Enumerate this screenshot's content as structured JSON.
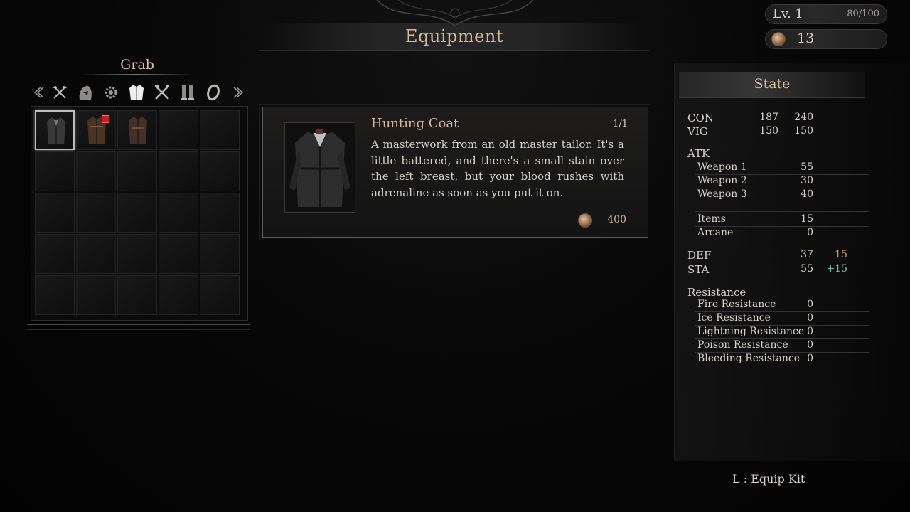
{
  "header": {
    "title": "Equipment",
    "level_label": "Lv. 1",
    "xp": "80/100",
    "currency": "13"
  },
  "inventory": {
    "title": "Grab",
    "categories": [
      {
        "icon": "axe-icon",
        "active": false
      },
      {
        "icon": "hood-icon",
        "active": false
      },
      {
        "icon": "gear-icon",
        "active": false
      },
      {
        "icon": "coat-icon",
        "active": true
      },
      {
        "icon": "crossed-tools-icon",
        "active": false
      },
      {
        "icon": "boots-icon",
        "active": false
      },
      {
        "icon": "ring-icon",
        "active": false
      }
    ],
    "slots": [
      {
        "item": "coat-dark",
        "selected": true,
        "new": false
      },
      {
        "item": "coat-brown",
        "selected": false,
        "new": true
      },
      {
        "item": "coat-brown",
        "selected": false,
        "new": false
      }
    ]
  },
  "detail": {
    "name": "Hunting Coat",
    "count": "1/1",
    "description": "A masterwork from an old master tailor. It's a little battered, and there's a small stain over the left breast, but your blood rushes with adrenaline as soon as you put it on.",
    "price": "400"
  },
  "state": {
    "title": "State",
    "con": {
      "label": "CON",
      "v1": "187",
      "v2": "240"
    },
    "vig": {
      "label": "VIG",
      "v1": "150",
      "v2": "150"
    },
    "atk": {
      "label": "ATK"
    },
    "weapon1": {
      "label": "Weapon 1",
      "value": "55"
    },
    "weapon2": {
      "label": "Weapon 2",
      "value": "30"
    },
    "weapon3": {
      "label": "Weapon 3",
      "value": "40"
    },
    "items": {
      "label": "Items",
      "value": "15"
    },
    "arcane": {
      "label": "Arcane",
      "value": "0"
    },
    "def": {
      "label": "DEF",
      "value": "37",
      "delta": "-15"
    },
    "sta": {
      "label": "STA",
      "value": "55",
      "delta": "+15"
    },
    "resistance": {
      "label": "Resistance"
    },
    "fire": {
      "label": "Fire Resistance",
      "value": "0"
    },
    "ice": {
      "label": "Ice Resistance",
      "value": "0"
    },
    "lightning": {
      "label": "Lightning Resistance",
      "value": "0"
    },
    "poison": {
      "label": "Poison Resistance",
      "value": "0"
    },
    "bleeding": {
      "label": "Bleeding Resistance",
      "value": "0"
    }
  },
  "footer": {
    "hint": "L : Equip Kit"
  },
  "colors": {
    "accent": "#d9b89a",
    "negative": "#d69a58",
    "positive": "#5fc7a5"
  }
}
